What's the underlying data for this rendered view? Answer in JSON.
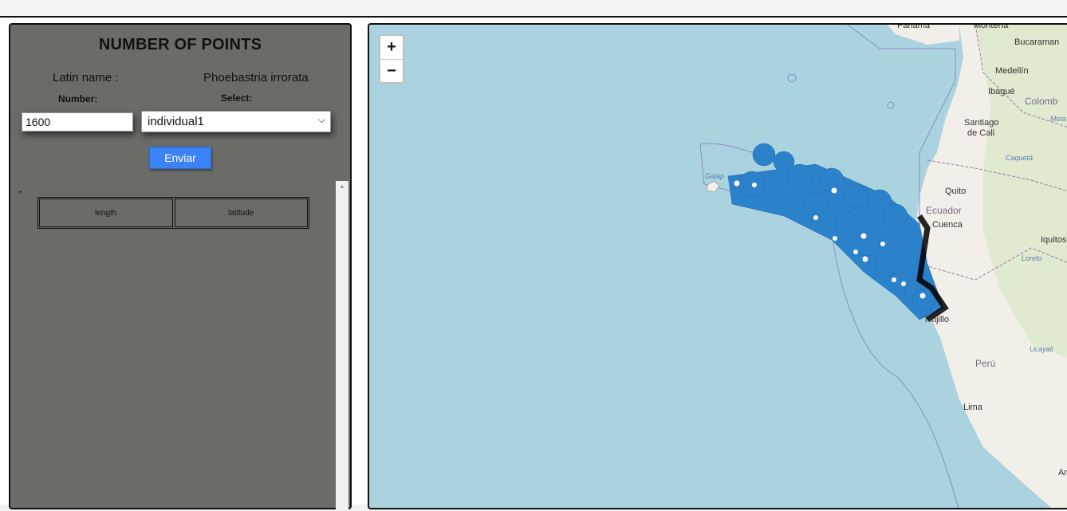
{
  "panel": {
    "title": "NUMBER OF POINTS",
    "latin_label": "Latin name :",
    "latin_value": "Phoebastria irrorata",
    "number_label": "Number:",
    "select_label": "Select:",
    "number_value": "1600",
    "select_value": "individual1",
    "send_label": "Enviar",
    "plus_mark": "+",
    "table_headers": [
      "length",
      "latitude"
    ]
  },
  "map": {
    "zoom_in": "+",
    "zoom_out": "−",
    "places": {
      "panama": "Panama",
      "monteria": "Montería",
      "bucaramanga": "Bucaraman",
      "medellin": "Medellín",
      "ibague": "Ibagué",
      "santiago_de_cali_1": "Santiago",
      "santiago_de_cali_2": "de Cali",
      "quito": "Quito",
      "cuenca": "Cuenca",
      "iquitos": "Iquitos",
      "trujillo": "Trujillo",
      "lima": "Lima",
      "ar": "Ar",
      "galapagos": "Galáp"
    },
    "countries": {
      "colombia": "Colomb",
      "ecuador": "Ecuador",
      "peru": "Perú"
    },
    "rivers": {
      "meta": "Meta",
      "caqueta": "Caquetá",
      "loreto": "Loreto",
      "ucayali": "Ucayali"
    },
    "colors": {
      "ocean": "#aad3df",
      "land": "#f2efe9",
      "marker": "#2b82cb",
      "panel": "#6b6b67",
      "button": "#3b82f6"
    }
  }
}
